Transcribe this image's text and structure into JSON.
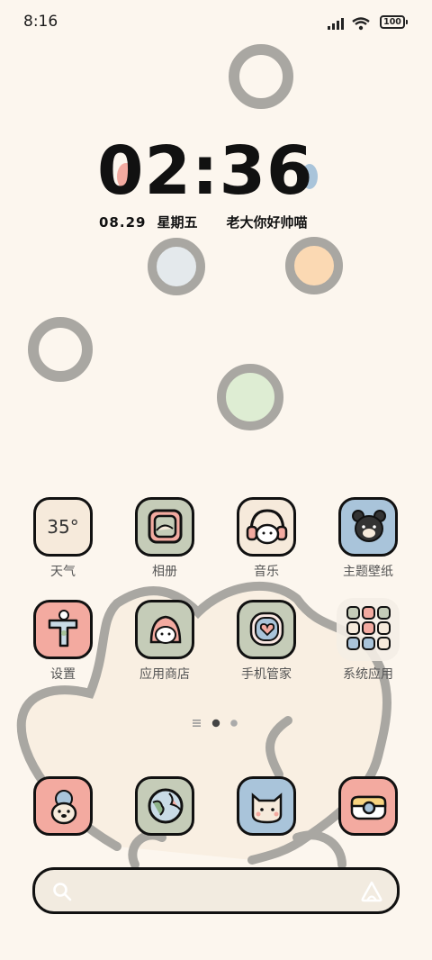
{
  "status_bar": {
    "time": "8:16",
    "battery": "100"
  },
  "clock_widget": {
    "time": "02:36",
    "date": "08.29",
    "weekday": "星期五",
    "motto": "老大你好帅喵"
  },
  "apps_row1": [
    {
      "label": "天气",
      "icon": "weather-icon",
      "text": "35°"
    },
    {
      "label": "相册",
      "icon": "gallery-icon"
    },
    {
      "label": "音乐",
      "icon": "music-icon"
    },
    {
      "label": "主题壁纸",
      "icon": "themes-icon"
    }
  ],
  "apps_row2": [
    {
      "label": "设置",
      "icon": "settings-icon"
    },
    {
      "label": "应用商店",
      "icon": "app-store-icon"
    },
    {
      "label": "手机管家",
      "icon": "security-icon"
    },
    {
      "label": "系统应用",
      "icon": "folder-icon"
    }
  ],
  "dock": [
    {
      "icon": "dog-face-icon"
    },
    {
      "icon": "browser-globe-icon"
    },
    {
      "icon": "cat-camera-icon"
    },
    {
      "icon": "camera-icon"
    }
  ],
  "page_indicator": {
    "pages": 2,
    "current": 1
  },
  "colors": {
    "background": "#fcf6ee",
    "pink": "#f3aaa0",
    "green": "#c5ccb8",
    "blue": "#a9c4da",
    "cream": "#f6eadb",
    "outline": "#111111"
  }
}
